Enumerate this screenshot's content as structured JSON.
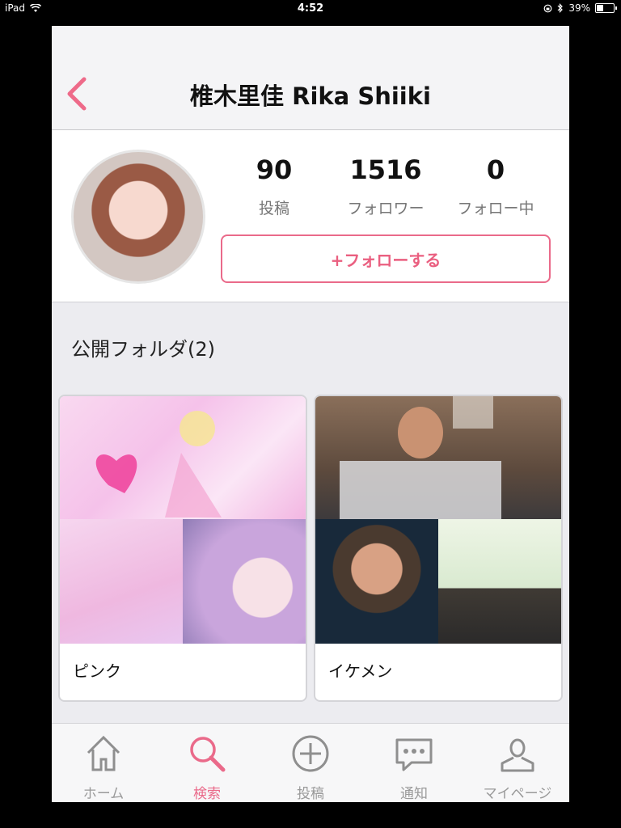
{
  "status_bar": {
    "device": "iPad",
    "time": "4:52",
    "battery": "39%",
    "battery_level": 0.39
  },
  "nav": {
    "title": "椎木里佳 Rika Shiiki",
    "back_icon": "chevron-left-icon"
  },
  "profile": {
    "stats": [
      {
        "value": "90",
        "label": "投稿"
      },
      {
        "value": "1516",
        "label": "フォロワー"
      },
      {
        "value": "0",
        "label": "フォロー中"
      }
    ],
    "follow_button": "+フォローする"
  },
  "section": {
    "title": "公開フォルダ(2)"
  },
  "folders": [
    {
      "name": "ピンク"
    },
    {
      "name": "イケメン"
    }
  ],
  "tabbar": {
    "items": [
      {
        "label": "ホーム",
        "icon": "home-icon"
      },
      {
        "label": "検索",
        "icon": "search-icon",
        "active": true
      },
      {
        "label": "投稿",
        "icon": "plus-circle-icon"
      },
      {
        "label": "通知",
        "icon": "chat-icon"
      },
      {
        "label": "マイページ",
        "icon": "person-icon"
      }
    ]
  },
  "colors": {
    "accent": "#ea6a8a",
    "background": "#ececf0"
  }
}
